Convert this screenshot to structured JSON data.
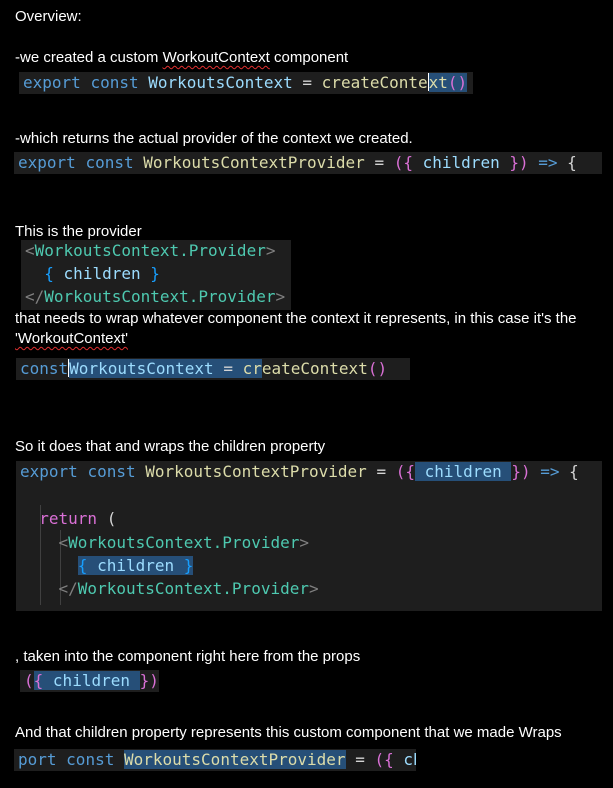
{
  "sections": {
    "overview": "Overview:",
    "s1_prefix": "-we created a custom ",
    "s1_squig": "WorkoutContext",
    "s1_suffix": " component",
    "s2": "-which returns the actual provider of the context we created.",
    "s3": "This is the provider",
    "s4": " that needs to wrap whatever component  the context it represents, in this case it's the",
    "s4b": "'WorkoutContext'",
    "s5": "So it does that and wraps the children property",
    "s6": ", taken into the component right here from the props",
    "s7": "And that children property represents this custom component that we made Wraps"
  },
  "code": {
    "export": "export",
    "const": "const",
    "workoutsContext": "WorkoutsContext",
    "createContext": "createContext",
    "createConte": "createConte",
    "xt": "xt",
    "eq": "=",
    "parens": "()",
    "provider": "WorkoutsContextProvider",
    "arrow": "=>",
    "brace_open": "{",
    "children": "children",
    "obj_open": "({",
    "obj_close": "})",
    "brace_close": "}",
    "tag_open": "<",
    "tag_close": ">",
    "tag_end_open": "</",
    "provider_tag": "WorkoutsContext.Provider",
    "return": "return",
    "lparen": "(",
    "bare_open": "{",
    "bare_close": "}",
    "const_sel_prefix": "const",
    "cr": "cr",
    "eateContext": "eateContext",
    "port": "port",
    "ch": "ch"
  }
}
